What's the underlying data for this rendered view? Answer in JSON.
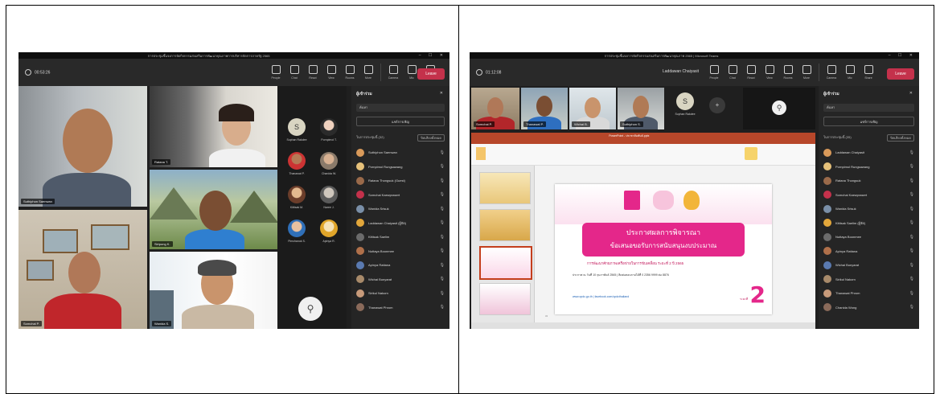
{
  "left": {
    "title_bar": "การประชุมชี้แจงการจัดกิจกรรมส่งเสริมการพัฒนาคุณภาพการบริหารจัดการภาครัฐ 2565",
    "window_controls": "– ☐ ✕",
    "timer": "00:53:26",
    "toolbar": [
      "People",
      "Chat",
      "React",
      "View",
      "Rooms",
      "More",
      "Camera",
      "Mic",
      "Share"
    ],
    "leave": "Leave",
    "tiles": [
      {
        "name": "Suthiphon Saenwan"
      },
      {
        "name": "Ratana T."
      },
      {
        "name": "Siripong K."
      },
      {
        "name": "Somchai P."
      },
      {
        "name": "Wanida S."
      }
    ],
    "avatars": [
      {
        "initial": "S",
        "label": "Suphan Rakdee"
      },
      {
        "label": "Pornpimol T."
      },
      {
        "label": "Thanawat P."
      },
      {
        "label": "Chanida W."
      },
      {
        "label": "Kittisak M."
      },
      {
        "label": "Naree J."
      },
      {
        "label": "Pimchanok S."
      },
      {
        "label": "Apinya R."
      },
      {
        "label": "Wichai B."
      },
      {
        "label": "Sirikul N."
      }
    ],
    "panel": {
      "header": "ผู้เข้าร่วม",
      "search": "ค้นหา",
      "share": "แชร์การเชิญ",
      "section": "ในการประชุมนี้ (32)",
      "mute_all": "ปิดเสียงทั้งหมด",
      "participants": [
        "Suthiphon Saenwan",
        "Pornpimol Rungsawang",
        "Ratana Thongsuk (Guest)",
        "Somchai Kaewprasert",
        "Wanida Srisuk",
        "Laddawan Chaiyasit (ผู้จัด)",
        "Kittisak Saelim",
        "Nuttaya Boonmee",
        "Apinya Rattana",
        "Wichai Bunyarat",
        "Sirikul Nakorn",
        "Thanawat Phrom"
      ]
    }
  },
  "right": {
    "title_bar": "การประชุมชี้แจงการจัดกิจกรรมส่งเสริมการพัฒนาคุณภาพ 2565 | Microsoft Teams",
    "window_controls": "– ☐ ✕",
    "timer": "01:12:08",
    "presenter": "Laddawan Chaiyasit",
    "toolbar": [
      "People",
      "Chat",
      "React",
      "View",
      "Rooms",
      "More",
      "Camera",
      "Mic",
      "Share"
    ],
    "leave": "Leave",
    "gallery": [
      {
        "name": "Somchai P."
      },
      {
        "name": "Thanawat P."
      },
      {
        "name": "Wichai B."
      },
      {
        "name": "Suthiphon S."
      },
      {
        "initial": "S",
        "name": "Suphan Rakdee"
      }
    ],
    "ppt": {
      "title": "PowerPoint - ประชาสัมพันธ์.pptx",
      "slide": {
        "line1": "ประกาศผลการพิจารณา",
        "line2": "ข้อเสนอขอรับการสนับสนุนงบประมาณ",
        "sub": "การพัฒนาศักยภาพเครือข่ายในการขับเคลื่อน ระยะที่ 2 ปี 2565",
        "info": "ประกาศ ณ วันที่ 10 กุมภาพันธ์ 2565 | ติดต่อสอบถามได้ที่ 0 2356 9999 ต่อ 8876",
        "links": "www.opdc.go.th   |   facebook.com/opdcthailand",
        "big": "2",
        "big_note": "ระยะที่"
      }
    },
    "panel": {
      "header": "ผู้เข้าร่วม",
      "search": "ค้นหา",
      "share": "แชร์การเชิญ",
      "section": "ในการประชุมนี้ (35)",
      "mute_all": "ปิดเสียงทั้งหมด",
      "participants": [
        "Laddawan Chaiyasit",
        "Pornpimol Rungsawang",
        "Ratana Thongsuk",
        "Somchai Kaewprasert",
        "Wanida Srisuk",
        "Kittisak Saelim (ผู้จัด)",
        "Nuttaya Boonmee",
        "Apinya Rattana",
        "Wichai Bunyarat",
        "Sirikul Nakorn",
        "Thanawat Phrom",
        "Chanida Wong"
      ]
    }
  }
}
